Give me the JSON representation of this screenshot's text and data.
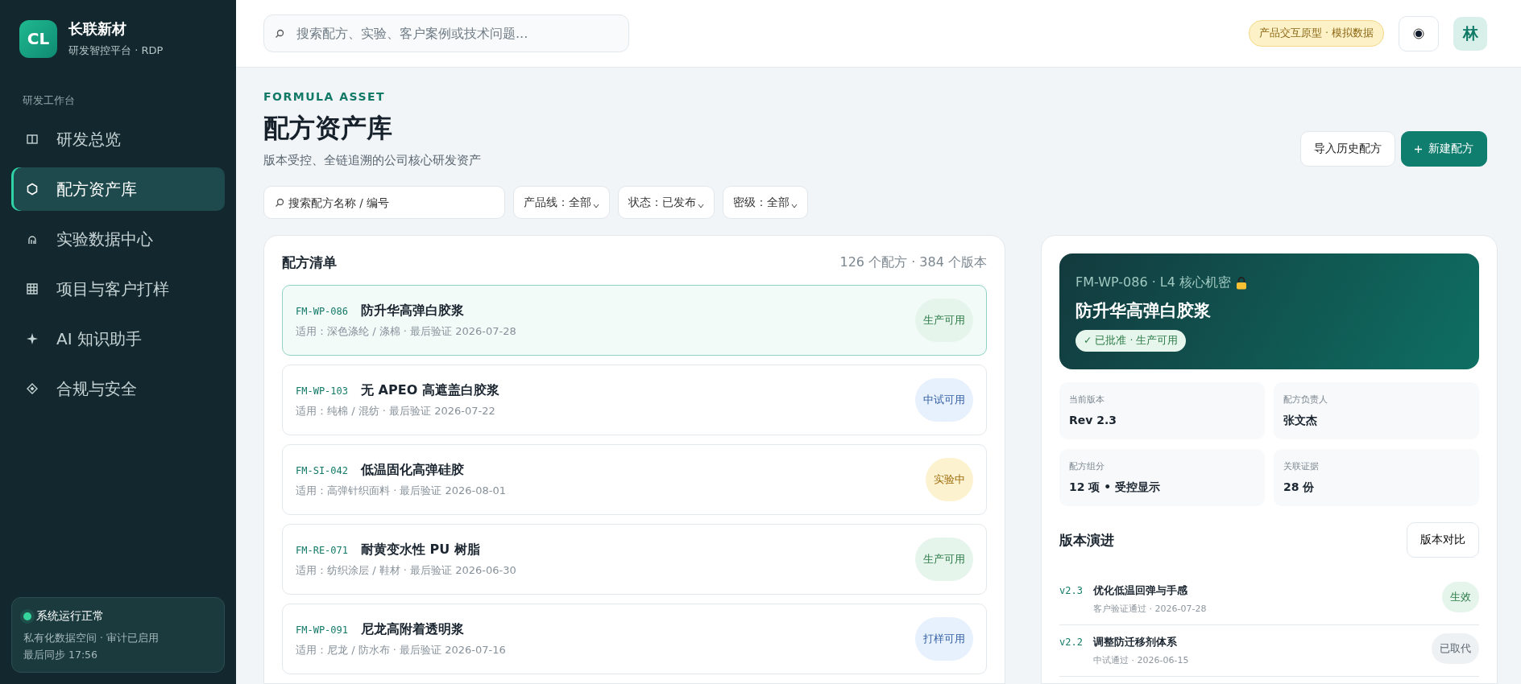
{
  "sidebar": {
    "brand": {
      "logo": "CL",
      "name": "长联新材",
      "subtitle": "研发智控平台 · RDP"
    },
    "section_label": "研发工作台",
    "items": [
      {
        "label": "研发总览",
        "selected": false
      },
      {
        "label": "配方资产库",
        "selected": true
      },
      {
        "label": "实验数据中心",
        "selected": false
      },
      {
        "label": "项目与客户打样",
        "selected": false
      },
      {
        "label": "AI 知识助手",
        "selected": false
      },
      {
        "label": "合规与安全",
        "selected": false
      }
    ],
    "status": {
      "title": "系统运行正常",
      "line1": "私有化数据空间 · 审计已启用",
      "line2": "最后同步 17:56"
    }
  },
  "topbar": {
    "search_placeholder": "搜索配方、实验、客户案例或技术问题...",
    "badge": "产品交互原型 · 模拟数据",
    "avatar": "林"
  },
  "header": {
    "eyebrow": "FORMULA ASSET",
    "title": "配方资产库",
    "subtitle": "版本受控、全链追溯的公司核心研发资产",
    "buttons": [
      {
        "label": "导入历史配方",
        "kind": "secondary"
      },
      {
        "label": "新建配方",
        "kind": "primary"
      }
    ]
  },
  "filters": {
    "search_placeholder": "搜索配方名称 / 编号",
    "selects": [
      "产品线：全部",
      "状态：已发布",
      "密级：全部"
    ]
  },
  "list": {
    "title": "配方清单",
    "count": "126 个配方 · 384 个版本",
    "rows": [
      {
        "code": "FM-WP-086",
        "name": "防升华高弹白胶浆",
        "meta": "适用：深色涤纶 / 涤棉 · 最后验证 2026-07-28",
        "status": "生产可用",
        "kind": "production",
        "selected": true
      },
      {
        "code": "FM-WP-103",
        "name": "无 APEO 高遮盖白胶浆",
        "meta": "适用：纯棉 / 混纺 · 最后验证 2026-07-22",
        "status": "中试可用",
        "kind": "pilot",
        "selected": false
      },
      {
        "code": "FM-SI-042",
        "name": "低温固化高弹硅胶",
        "meta": "适用：高弹针织面料 · 最后验证 2026-08-01",
        "status": "实验中",
        "kind": "experiment",
        "selected": false
      },
      {
        "code": "FM-RE-071",
        "name": "耐黄变水性 PU 树脂",
        "meta": "适用：纺织涂层 / 鞋材 · 最后验证 2026-06-30",
        "status": "生产可用",
        "kind": "production",
        "selected": false
      },
      {
        "code": "FM-WP-091",
        "name": "尼龙高附着透明浆",
        "meta": "适用：尼龙 / 防水布 · 最后验证 2026-07-16",
        "status": "打样可用",
        "kind": "pilot",
        "selected": false
      }
    ]
  },
  "detail": {
    "code_line": "FM-WP-086 · L4 核心机密",
    "name": "防升华高弹白胶浆",
    "approval": "✓ 已批准 · 生产可用",
    "facts": [
      {
        "label": "当前版本",
        "value": "Rev 2.3"
      },
      {
        "label": "配方负责人",
        "value": "张文杰"
      },
      {
        "label": "配方组分",
        "value": "12 项 • 受控显示"
      },
      {
        "label": "关联证据",
        "value": "28 份"
      }
    ],
    "versions_title": "版本演进",
    "compare_button": "版本对比",
    "versions": [
      {
        "version": "v2.3",
        "title": "优化低温回弹与手感",
        "meta": "客户验证通过 · 2026-07-28",
        "status": "生效",
        "kind": "active"
      },
      {
        "version": "v2.2",
        "title": "调整防迁移剂体系",
        "meta": "中试通过 · 2026-06-15",
        "status": "已取代",
        "kind": "superseded"
      }
    ]
  }
}
